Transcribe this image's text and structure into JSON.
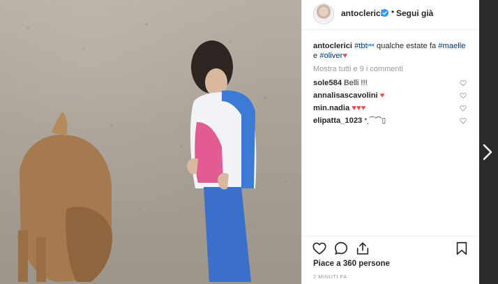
{
  "post": {
    "username": "antoclerici",
    "dot": "•",
    "follow_label": "Segui già",
    "caption": {
      "username": "antoclerici",
      "tag_tbt": "#tbt",
      "tbt_emoji": "⏮",
      "text_1": " qualche estate fa ",
      "tag_maelle": "#maelle",
      "text_2": " e ",
      "tag_oliver": "#oliver",
      "heart": "♥"
    },
    "view_all_comments": "Mostra tutti e 9 i commenti",
    "comments": [
      {
        "user": "sole584",
        "text": "Belli !!!"
      },
      {
        "user": "annalisascavolini",
        "text": "♥"
      },
      {
        "user": "min.nadia",
        "text": "♥♥♥"
      },
      {
        "user": "elipatta_1023",
        "text": "*˛⁀⌒▯"
      }
    ],
    "likes": "Piace a 360 persone",
    "time": "2 MINUTI FA"
  },
  "colors": {
    "link": "#003569",
    "secondary_text": "#999999",
    "verified": "#3897f0",
    "heart": "#ed4956"
  },
  "icons": {
    "verified": "verified-badge-icon",
    "like": "heart-outline-icon",
    "comment": "comment-bubble-icon",
    "share": "share-icon",
    "save": "bookmark-icon",
    "next": "chevron-right-icon"
  }
}
